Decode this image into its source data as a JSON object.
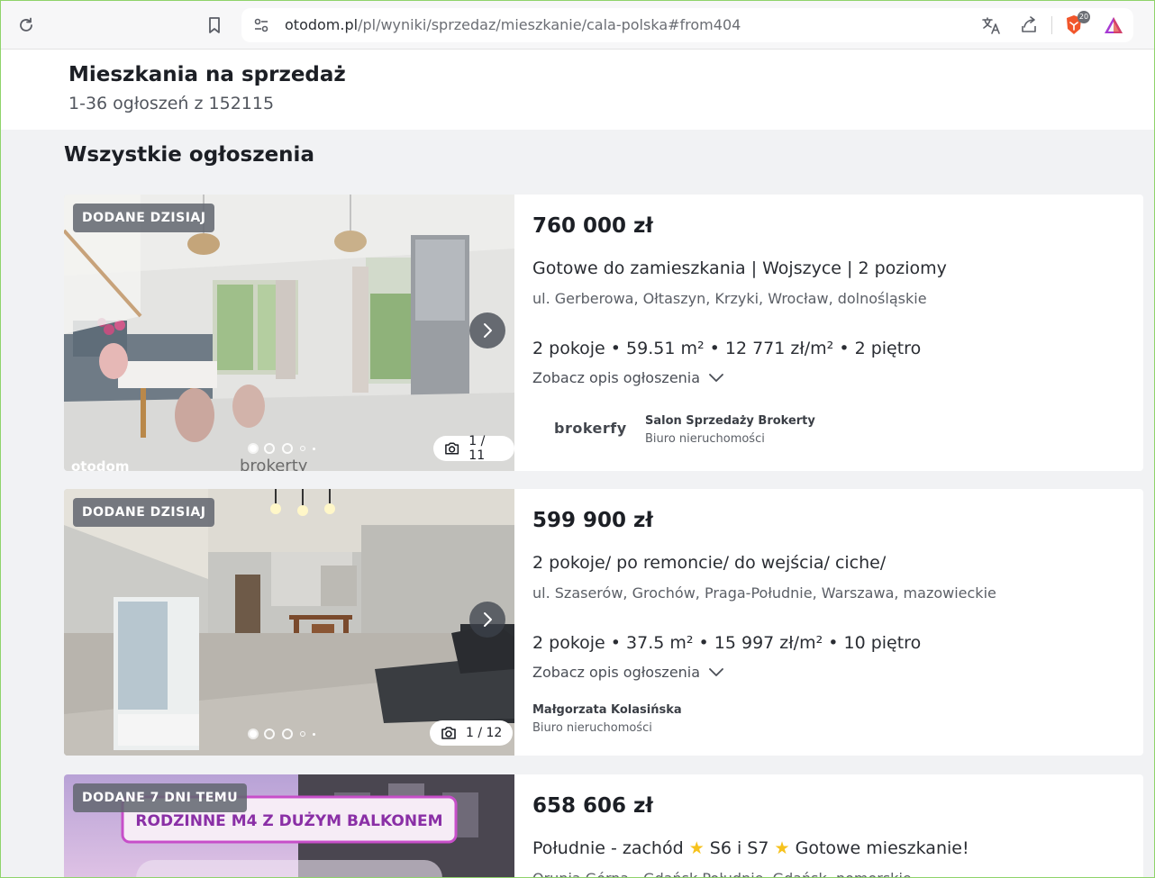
{
  "browser": {
    "url_host": "otodom.pl",
    "url_path": "/pl/wyniki/sprzedaz/mieszkanie/cala-polska#from404",
    "shield_count": "20",
    "icons": [
      "reload-icon",
      "bookmark-icon",
      "site-settings-icon",
      "translate-icon",
      "share-icon",
      "brave-shield-icon",
      "brave-rewards-icon"
    ]
  },
  "header": {
    "title": "Mieszkania na sprzedaż",
    "count": "1-36 ogłoszeń z 152115"
  },
  "section_title": "Wszystkie ogłoszenia",
  "listings": [
    {
      "badge": "DODANE DZISIAJ",
      "price": "760 000 zł",
      "title": "Gotowe do zamieszkania | Wojszyce | 2 poziomy",
      "address": "ul. Gerberowa, Ołtaszyn, Krzyki, Wrocław, dolnośląskie",
      "params": "2 pokoje • 59.51 m² • 12 771 zł/m² • 2 piętro",
      "desc_link": "Zobacz opis ogłoszenia",
      "photo_counter": "1 / 11",
      "agency_logo": "brokerfy",
      "agency_name": "Salon Sprzedaży Brokerty",
      "agency_type": "Biuro nieruchomości",
      "photo_watermark": "otodom",
      "photo_watermark_2": "brokerty"
    },
    {
      "badge": "DODANE DZISIAJ",
      "price": "599 900 zł",
      "title": "2 pokoje/ po remoncie/ do wejścia/ ciche/",
      "address": "ul. Szaserów, Grochów, Praga-Południe, Warszawa, mazowieckie",
      "params": "2 pokoje • 37.5 m² • 15 997 zł/m² • 10 piętro",
      "desc_link": "Zobacz opis ogłoszenia",
      "photo_counter": "1 / 12",
      "agency_name": "Małgorzata Kolasińska",
      "agency_type": "Biuro nieruchomości"
    },
    {
      "badge": "DODANE 7 DNI TEMU",
      "price": "658 606 zł",
      "title_part1": "Południe - zachód",
      "title_part2": "S6 i S7",
      "title_part3": "Gotowe mieszkanie!",
      "address": "Orunia Górna - Gdańsk Południe, Gdańsk, pomorskie",
      "banner": "RODZINNE M4 Z DUŻYM BALKONEM"
    }
  ]
}
